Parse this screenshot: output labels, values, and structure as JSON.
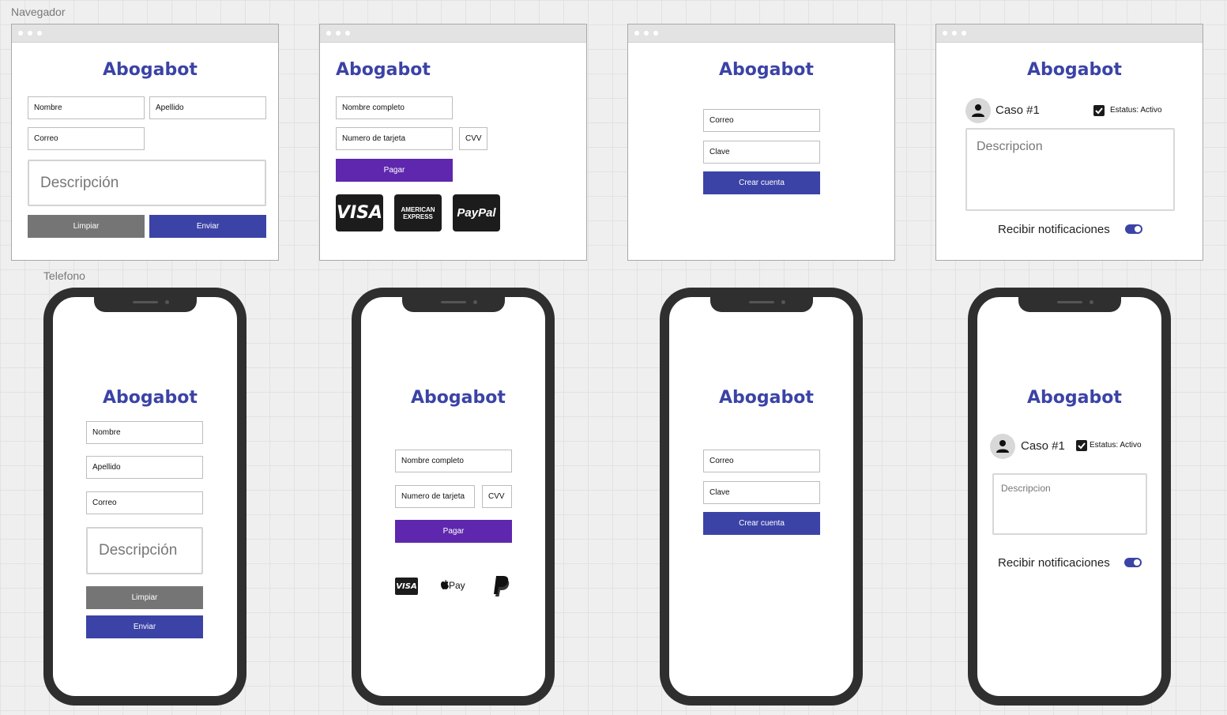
{
  "labels": {
    "browser_section": "Navegador",
    "phone_section": "Telefono"
  },
  "app": {
    "title": "Abogabot"
  },
  "register_form": {
    "first_name": "Nombre",
    "last_name": "Apellido",
    "email": "Correo",
    "description": "Descripción",
    "clear_button": "Limpiar",
    "send_button": "Enviar"
  },
  "payment_form": {
    "full_name": "Nombre completo",
    "card_number": "Numero de tarjeta",
    "cvv": "CVV",
    "pay_button": "Pagar",
    "methods_desktop": [
      "VISA",
      "AMERICAN EXPRESS",
      "PayPal"
    ],
    "methods_phone": [
      "VISA",
      "Pay",
      "P"
    ]
  },
  "signup_form": {
    "email": "Correo",
    "password": "Clave",
    "create_button": "Crear cuenta"
  },
  "case_view": {
    "case_title": "Caso #1",
    "status": "Estatus: Activo",
    "description": "Descripcion",
    "notifications": "Recibir notificaciones"
  },
  "colors": {
    "accent": "#3b43a6",
    "purple": "#5f27ad",
    "gray_button": "#757575"
  },
  "icons": [
    "user-icon",
    "check-icon",
    "toggle-on-icon",
    "apple-icon",
    "paypal-icon"
  ]
}
